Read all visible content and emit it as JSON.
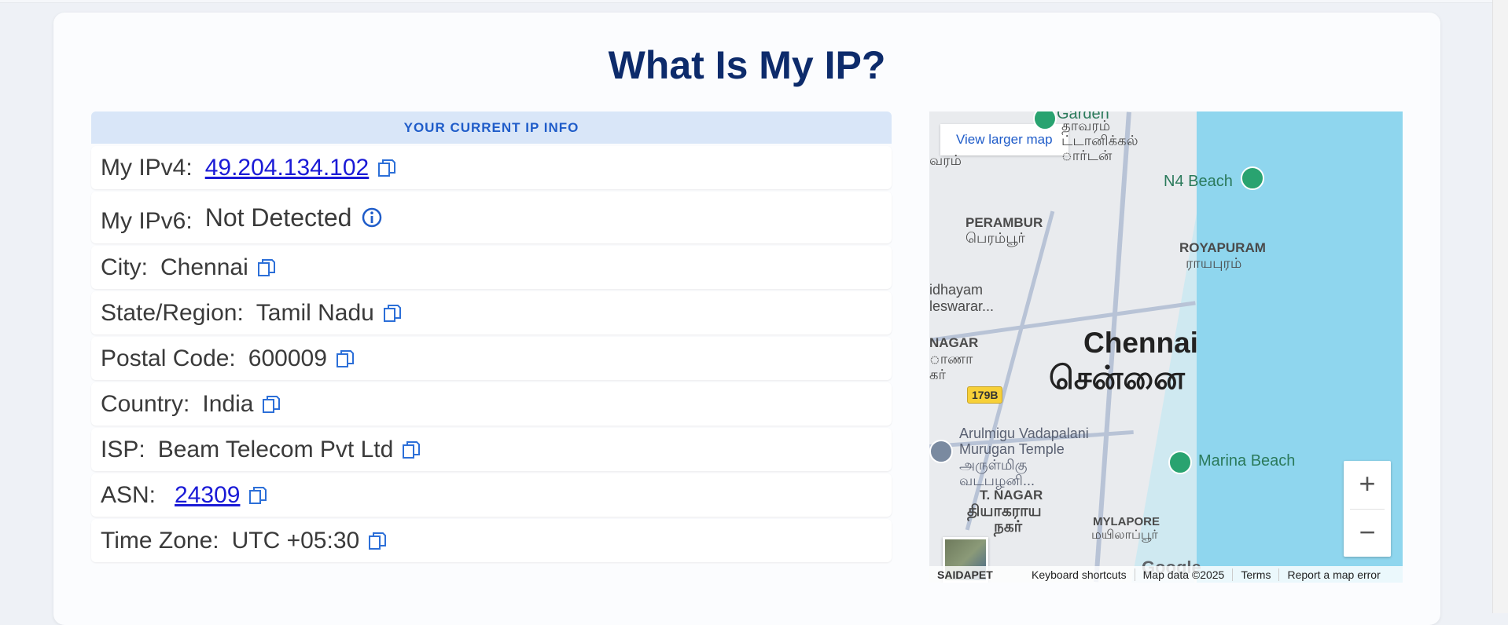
{
  "page": {
    "title": "What Is My IP?"
  },
  "panel": {
    "header": "YOUR CURRENT IP INFO",
    "rows": [
      {
        "label": "My IPv4:",
        "value": "49.204.134.102",
        "link": true,
        "icon": "copy-icon"
      },
      {
        "label": "My IPv6:",
        "value": "Not Detected",
        "link": false,
        "icon": "info-icon"
      },
      {
        "label": "City:",
        "value": "Chennai",
        "link": false,
        "icon": "copy-icon"
      },
      {
        "label": "State/Region:",
        "value": "Tamil Nadu",
        "link": false,
        "icon": "copy-icon"
      },
      {
        "label": "Postal Code:",
        "value": "600009",
        "link": false,
        "icon": "copy-icon"
      },
      {
        "label": "Country:",
        "value": "India",
        "link": false,
        "icon": "copy-icon"
      },
      {
        "label": "ISP:",
        "value": "Beam Telecom Pvt Ltd",
        "link": false,
        "icon": "copy-icon"
      },
      {
        "label": "ASN:",
        "value": "24309",
        "link": true,
        "icon": "copy-icon"
      },
      {
        "label": "Time Zone:",
        "value": "UTC +05:30",
        "link": false,
        "icon": "copy-icon"
      }
    ]
  },
  "map": {
    "view_larger": "View larger map",
    "labels": {
      "garden": "Garden",
      "garden_ta1": "தாவரம்",
      "garden_ta2": "ட்டானிக்கல்",
      "garden_ta3": "ார்டன்",
      "varam": "வரம்",
      "n4_beach": "N4 Beach",
      "perambur": "PERAMBUR",
      "perambur_ta": "பெரம்பூர்",
      "royapuram": "ROYAPURAM",
      "royapuram_ta": "ராயபுரம்",
      "idhayam": "idhayam",
      "leswarar": "leswarar...",
      "nagar": "NAGAR",
      "nagar_ta1": "ாணா",
      "nagar_ta2": "கர்",
      "chennai": "Chennai",
      "chennai_ta": "சென்னை",
      "route": "179B",
      "vadapalani1": "Arulmigu Vadapalani",
      "vadapalani2": "Murugan Temple",
      "vadapalani_ta1": "அருள்மிகு",
      "vadapalani_ta2": "வடபழனி...",
      "marina": "Marina Beach",
      "tnagar": "T. NAGAR",
      "tnagar_ta1": "தியாகராய",
      "tnagar_ta2": "நகர்",
      "mylapore": "MYLAPORE",
      "mylapore_ta": "மயிலாப்பூர்",
      "saidapet": "SAIDAPET"
    },
    "zoom_in": "+",
    "zoom_out": "−",
    "google": "Google",
    "footer": [
      "Keyboard shortcuts",
      "Map data ©2025",
      "Terms",
      "Report a map error"
    ]
  }
}
